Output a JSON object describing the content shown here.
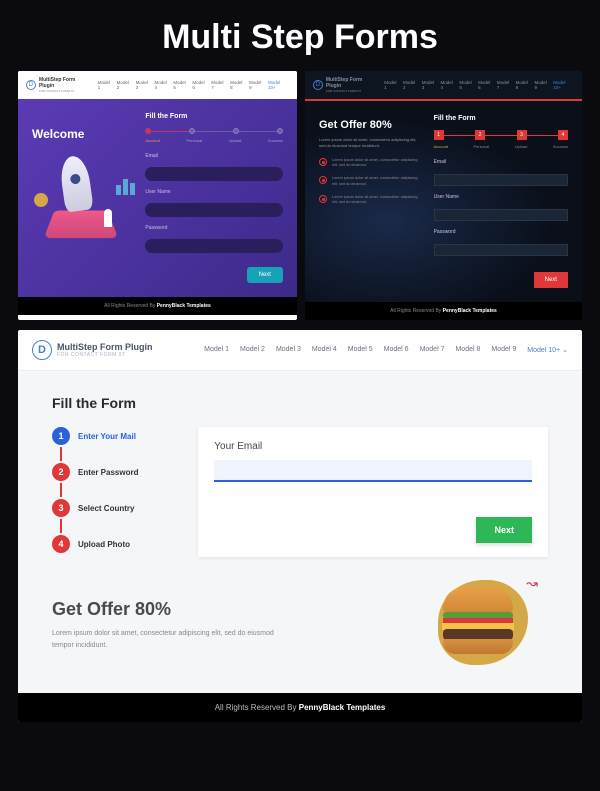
{
  "hero": "Multi Step Forms",
  "logo": {
    "title": "MultiStep Form Plugin",
    "subtitle": "FOR CONTACT FORM 07"
  },
  "nav": {
    "items": [
      "Model 1",
      "Model 2",
      "Model 3",
      "Model 4",
      "Model 5",
      "Model 6",
      "Model 7",
      "Model 8",
      "Model 9"
    ],
    "last": "Model 10+"
  },
  "card1": {
    "welcome": "Welcome",
    "fill": "Fill the Form",
    "steps": [
      "Account",
      "Personal",
      "Upload",
      "Success"
    ],
    "fields": {
      "email": "Email",
      "username": "User Name",
      "password": "Password"
    },
    "next": "Next"
  },
  "card2": {
    "offer": "Get Offer 80%",
    "lorem": "Lorem ipsum dolor sit amet, consectetur adipiscing elit, sed do eiusmod tempor incididunt.",
    "bullet": "Lorem ipsum dolor sit amet, consectetur adipiscing elit, sed do eiusmod.",
    "fill": "Fill the Form",
    "stepnums": [
      "1",
      "2",
      "3",
      "4"
    ],
    "steps": [
      "Account",
      "Personal",
      "Upload",
      "Success"
    ],
    "fields": {
      "email": "Email",
      "username": "User Name",
      "password": "Password"
    },
    "next": "Next"
  },
  "card3": {
    "fill": "Fill the Form",
    "steps": [
      {
        "num": "1",
        "label": "Enter Your Mail"
      },
      {
        "num": "2",
        "label": "Enter Password"
      },
      {
        "num": "3",
        "label": "Select Country"
      },
      {
        "num": "4",
        "label": "Upload Photo"
      }
    ],
    "email_label": "Your Email",
    "next": "Next",
    "offer": "Get Offer 80%",
    "lorem": "Lorem ipsum dolor sit amet, consectetur adipiscing elit, sed do eiusmod tempor incididunt."
  },
  "footer": {
    "text": "All Rights Reserved By ",
    "brand": "PennyBlack Templates"
  }
}
